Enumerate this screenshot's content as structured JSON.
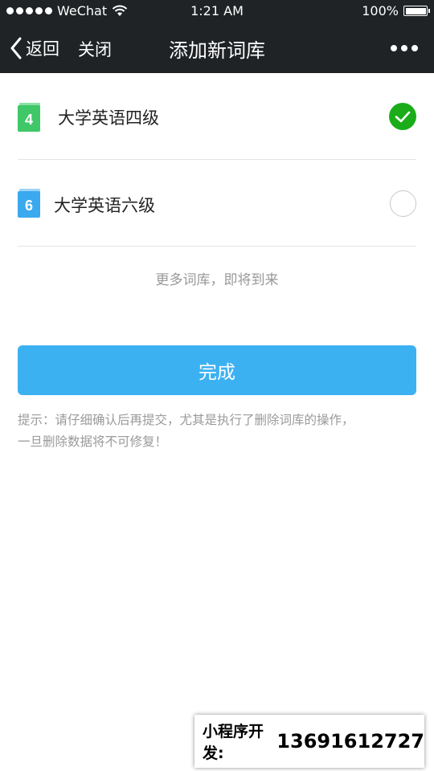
{
  "status_bar": {
    "carrier": "WeChat",
    "time": "1:21 AM",
    "battery": "100%",
    "battery_level": 1.0
  },
  "nav": {
    "back_label": "返回",
    "close_label": "关闭",
    "title": "添加新词库"
  },
  "wordbanks": [
    {
      "icon_number": "4",
      "label": "大学英语四级",
      "selected": true,
      "icon_color": "#3fc768"
    },
    {
      "icon_number": "6",
      "label": "大学英语六级",
      "selected": false,
      "icon_color": "#3aa9ee"
    }
  ],
  "more_text": "更多词库，即将到来",
  "done_label": "完成",
  "tip_lines": [
    "提示：请仔细确认后再提交，尤其是执行了删除词库的操作，",
    "一旦删除数据将不可修复！"
  ],
  "watermark": {
    "label": "小程序开发:",
    "phone": "13691612727"
  },
  "colors": {
    "header_bg": "#1f2326",
    "primary_button": "#3cb1f2",
    "checked_green": "#1aad19"
  }
}
